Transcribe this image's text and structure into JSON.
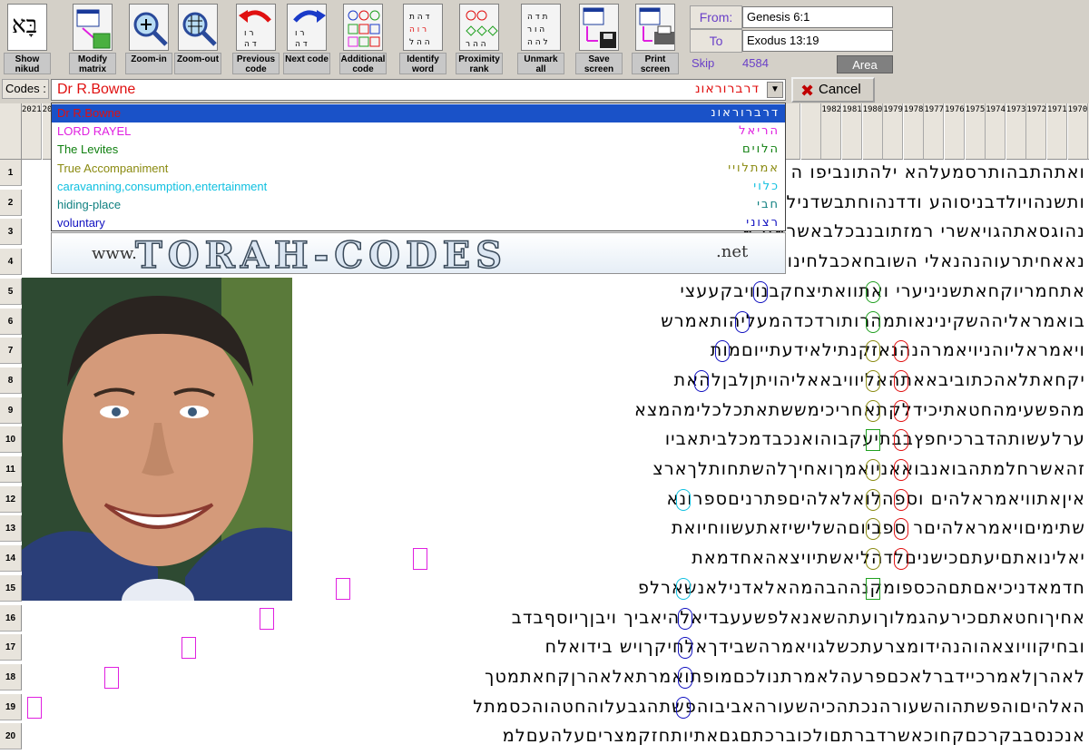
{
  "toolbar": {
    "buttons": [
      {
        "id": "show-nikud",
        "label": "Show nikud",
        "icon": "nikud-icon"
      },
      {
        "id": "modify-matrix",
        "label": "Modify matrix",
        "icon": "matrix-icon"
      },
      {
        "id": "zoom-in",
        "label": "Zoom-in",
        "icon": "zoom-in-icon"
      },
      {
        "id": "zoom-out",
        "label": "Zoom-out",
        "icon": "zoom-out-icon"
      },
      {
        "id": "previous-code",
        "label": "Previous code",
        "icon": "previous-code-icon"
      },
      {
        "id": "next-code",
        "label": "Next code",
        "icon": "next-code-icon"
      },
      {
        "id": "additional-code",
        "label": "Additional code",
        "icon": "additional-code-icon"
      },
      {
        "id": "identify-word",
        "label": "Identify word",
        "icon": "identify-word-icon"
      },
      {
        "id": "proximity-rank",
        "label": "Proximity rank",
        "icon": "proximity-rank-icon"
      },
      {
        "id": "unmark-all",
        "label": "Unmark all",
        "icon": "unmark-all-icon"
      },
      {
        "id": "save-screen",
        "label": "Save screen",
        "icon": "save-icon"
      },
      {
        "id": "print-screen",
        "label": "Print screen",
        "icon": "printer-icon"
      }
    ],
    "nikud_glyph": "בָּא"
  },
  "range": {
    "from_label": "From:",
    "from_value": "Genesis 6:1",
    "to_label": "To",
    "to_value": "Exodus 13:19",
    "skip_label": "Skip",
    "skip_value": "4584",
    "area_label": "Area"
  },
  "codes": {
    "label": "Codes :",
    "selected_name": "Dr R.Bowne",
    "selected_hebrew": "דרברוראונ",
    "cancel_label": "Cancel",
    "list": [
      {
        "name": "Dr R.Bowne",
        "hebrew": "דרברוראונ",
        "color": "#e01010"
      },
      {
        "name": "LORD RAYEL",
        "hebrew": "הריאל",
        "color": "#e020e0"
      },
      {
        "name": "The Levites",
        "hebrew": "הלוים",
        "color": "#108010"
      },
      {
        "name": "True Accompaniment",
        "hebrew": "אמתלויי",
        "color": "#8a8a10"
      },
      {
        "name": "caravanning,consumption,entertainment",
        "hebrew": "כלוי",
        "color": "#10c0e0"
      },
      {
        "name": "hiding-place",
        "hebrew": "חבי",
        "color": "#108080"
      },
      {
        "name": "voluntary",
        "hebrew": "רצוני",
        "color": "#1010c0"
      }
    ]
  },
  "banner": {
    "www": "www.",
    "main": "TORAH-CODES",
    "net": ".net"
  },
  "grid": {
    "column_headers": [
      "2021",
      "2020",
      "",
      "",
      "",
      "",
      "",
      "",
      "",
      "",
      "",
      "",
      "",
      "",
      "",
      "",
      "",
      "",
      "",
      "",
      "",
      "",
      "",
      "",
      "",
      "",
      "",
      "",
      "",
      "",
      "",
      "",
      "",
      "",
      "",
      "",
      "",
      "",
      "",
      "1982",
      "1981",
      "1980",
      "1979",
      "1978",
      "1977",
      "1976",
      "1975",
      "1974",
      "1973",
      "1972",
      "1971",
      "1970",
      "1969",
      "1968",
      "1967"
    ],
    "row_numbers": [
      "1",
      "2",
      "3",
      "4",
      "5",
      "6",
      "7",
      "8",
      "9",
      "10",
      "11",
      "12",
      "13",
      "14",
      "15",
      "16",
      "17",
      "18",
      "19",
      "20"
    ],
    "rows": [
      "ואתהתבהותרסמעלהא ילהתונביפו ה שאמשינבבשני",
      "ותשנהויולדבניסוהע ודדנהוחתבשדנילוגויב",
      "נהוגסאתהגויאשרי רמזתובנבכלבאשראמ א",
      "נאאחיתרעוהנהנאלי השובחאכבלחינואלהאמפ",
      "אתחמריוקחאתשניניערי ואתוואתיצחקבנוויבקעעצי",
      "בואמראליההשקינינאותמהרותורדכדהמעליהותאמרש",
      "ויאמראליוהניויאמרהנהנאזקנתילאידעתייוםמות",
      "יקחאתלאהכתוביבאאתהאליוויבאאליהויתןלבןלהאת",
      "מהפשעימהחטאתיכידלקתאחריכימששתאתכלכלימהמצא",
      "ערלעשותהדברכיחפץבבתיעקבוהואנכבדמכלביתאביו",
      "זהאשרחלמתהבואנבואאניואמךואחיךלהשתחותלךארצ",
      "איןאתוויאמראלהים וספהלואלאלהיםפתרניםספרונא",
      "שתימיםויאמראלהיםר ספביוםהשלישיזאתעשווחיואת",
      "יאלינואתםיעתםכישניםלדהליאשתיויצאהאחדמאת",
      "חדמאדניכיאםתםהכספומקנההבהמהאלאדנילאנשארלפ",
      "אחיךוחטאתםכירעהגמלוךועתהשאנאלפשעעבדיאלהיאביך ויבןךיוסףבדב",
      "ובחיקוויוצאהוהנהידומצרעתכשלגויאמרהשבידךאלחיקךויש בידואלח",
      "לאהרןלאמרכיידברלאכםפרעהלאמרתנולכםמופתואמרתאלאהרןקחאתמטך",
      "האלהיםוהפשתהוהשעורהנכתהכיהשעורהאביבוהפשתהגבעלוהחטהוהכסמתל",
      "אנכנסבבקרכםקחוכאשרדברתםולכוברכתםגםאתיותחזקמצריםעלהעםלמ"
    ]
  }
}
